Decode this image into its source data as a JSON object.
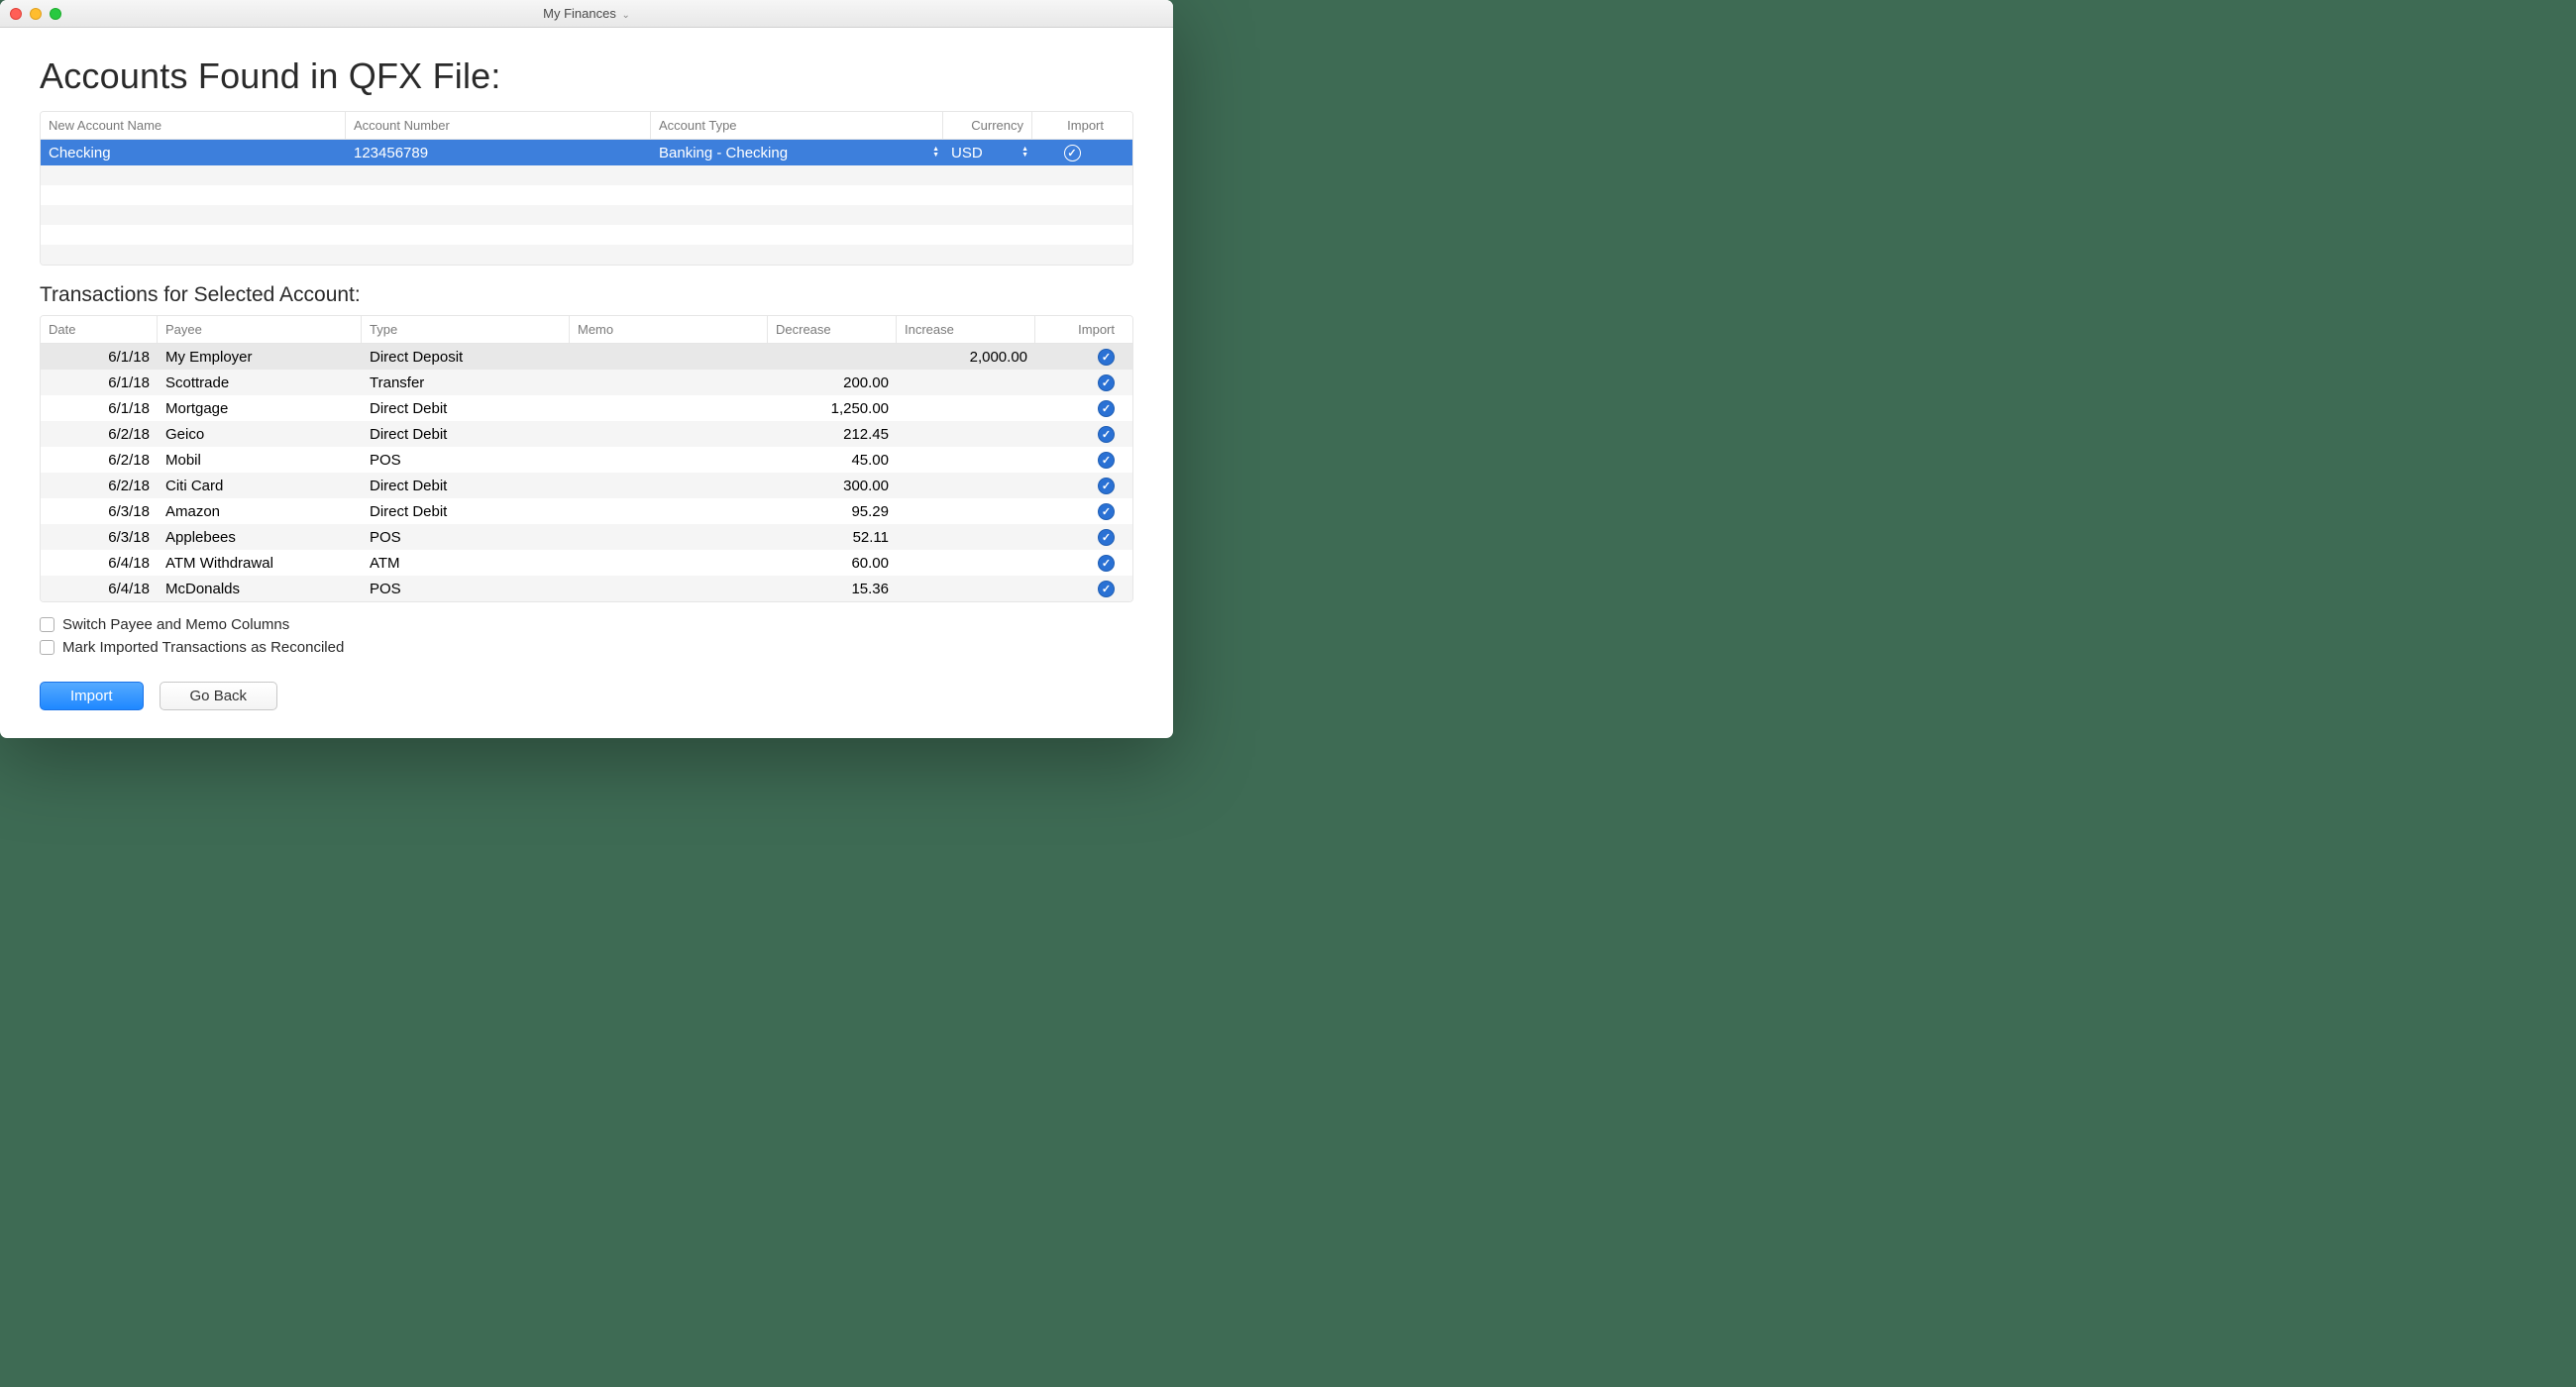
{
  "window": {
    "title": "My Finances"
  },
  "headings": {
    "accounts": "Accounts Found in QFX File:",
    "transactions": "Transactions for Selected Account:"
  },
  "accounts_table": {
    "headers": {
      "name": "New Account Name",
      "number": "Account Number",
      "type": "Account Type",
      "currency": "Currency",
      "import": "Import"
    },
    "rows": [
      {
        "name": "Checking",
        "number": "123456789",
        "type": "Banking - Checking",
        "currency": "USD",
        "import": true,
        "selected": true
      }
    ]
  },
  "transactions_table": {
    "headers": {
      "date": "Date",
      "payee": "Payee",
      "type": "Type",
      "memo": "Memo",
      "decrease": "Decrease",
      "increase": "Increase",
      "import": "Import"
    },
    "rows": [
      {
        "date": "6/1/18",
        "payee": "My Employer",
        "type": "Direct Deposit",
        "memo": "",
        "decrease": "",
        "increase": "2,000.00",
        "import": true,
        "highlight": true
      },
      {
        "date": "6/1/18",
        "payee": "Scottrade",
        "type": "Transfer",
        "memo": "",
        "decrease": "200.00",
        "increase": "",
        "import": true
      },
      {
        "date": "6/1/18",
        "payee": "Mortgage",
        "type": "Direct Debit",
        "memo": "",
        "decrease": "1,250.00",
        "increase": "",
        "import": true
      },
      {
        "date": "6/2/18",
        "payee": "Geico",
        "type": "Direct Debit",
        "memo": "",
        "decrease": "212.45",
        "increase": "",
        "import": true
      },
      {
        "date": "6/2/18",
        "payee": "Mobil",
        "type": "POS",
        "memo": "",
        "decrease": "45.00",
        "increase": "",
        "import": true
      },
      {
        "date": "6/2/18",
        "payee": "Citi Card",
        "type": "Direct Debit",
        "memo": "",
        "decrease": "300.00",
        "increase": "",
        "import": true
      },
      {
        "date": "6/3/18",
        "payee": "Amazon",
        "type": "Direct Debit",
        "memo": "",
        "decrease": "95.29",
        "increase": "",
        "import": true
      },
      {
        "date": "6/3/18",
        "payee": "Applebees",
        "type": "POS",
        "memo": "",
        "decrease": "52.11",
        "increase": "",
        "import": true
      },
      {
        "date": "6/4/18",
        "payee": "ATM Withdrawal",
        "type": "ATM",
        "memo": "",
        "decrease": "60.00",
        "increase": "",
        "import": true
      },
      {
        "date": "6/4/18",
        "payee": "McDonalds",
        "type": "POS",
        "memo": "",
        "decrease": "15.36",
        "increase": "",
        "import": true
      }
    ]
  },
  "options": {
    "switch_columns": "Switch Payee and Memo Columns",
    "mark_reconciled": "Mark Imported Transactions as Reconciled"
  },
  "buttons": {
    "import": "Import",
    "go_back": "Go Back"
  }
}
